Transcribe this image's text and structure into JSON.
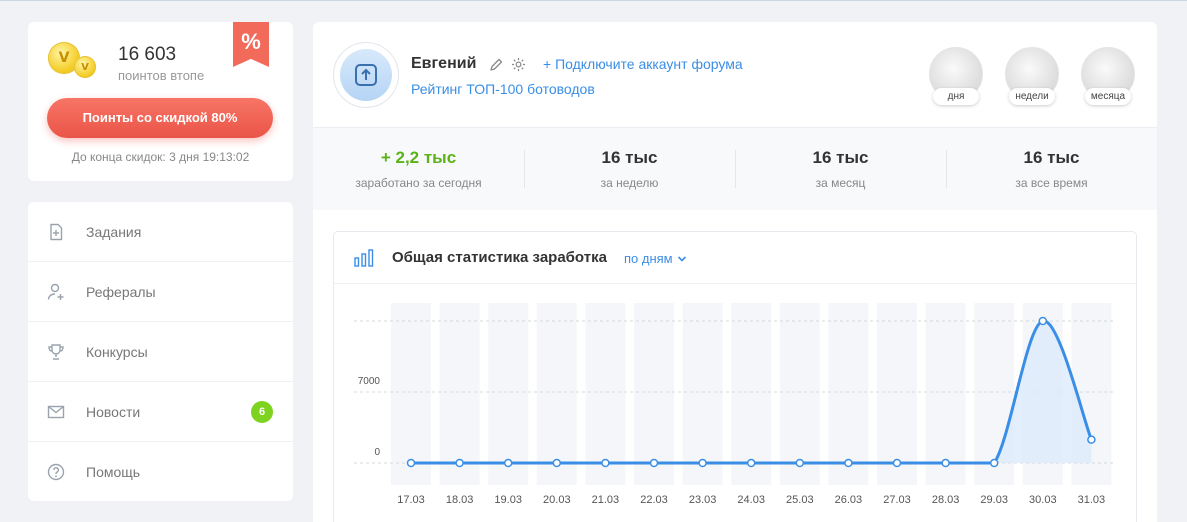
{
  "points": {
    "value": "16 603",
    "label": "поинтов втопе",
    "badge": "%",
    "coin_symbol": "V",
    "discount_button": "Поинты со скидкой 80%",
    "countdown": "До конца скидок: 3 дня 19:13:02"
  },
  "sidebar": {
    "items": [
      {
        "label": "Задания",
        "icon": "task-icon"
      },
      {
        "label": "Рефералы",
        "icon": "user-add-icon"
      },
      {
        "label": "Конкурсы",
        "icon": "trophy-icon"
      },
      {
        "label": "Новости",
        "icon": "mail-icon",
        "badge": "6"
      },
      {
        "label": "Помощь",
        "icon": "help-icon"
      }
    ]
  },
  "profile": {
    "name": "Евгений",
    "forum_link": "+ Подключите аккаунт форума",
    "rating_link": "Рейтинг ТОП-100 ботоводов",
    "medals": [
      {
        "label": "дня"
      },
      {
        "label": "недели"
      },
      {
        "label": "месяца"
      }
    ]
  },
  "stats": [
    {
      "value": "+ 2,2 тыс",
      "label": "заработано за сегодня",
      "color": "#5bb318"
    },
    {
      "value": "16 тыс",
      "label": "за неделю"
    },
    {
      "value": "16 тыс",
      "label": "за месяц"
    },
    {
      "value": "16 тыс",
      "label": "за все время"
    }
  ],
  "chart_panel": {
    "title": "Общая статистика заработка",
    "period": "по дням"
  },
  "chart_data": {
    "type": "area",
    "x": [
      "17.03",
      "18.03",
      "19.03",
      "20.03",
      "21.03",
      "22.03",
      "23.03",
      "24.03",
      "25.03",
      "26.03",
      "27.03",
      "28.03",
      "29.03",
      "30.03",
      "31.03"
    ],
    "series": [
      {
        "values": [
          0,
          0,
          0,
          0,
          0,
          0,
          0,
          0,
          0,
          0,
          0,
          0,
          0,
          14000,
          2300
        ]
      }
    ],
    "y_ticks": [
      0,
      7000
    ],
    "ylim": [
      0,
      14000
    ],
    "grid": true,
    "colors": {
      "line": "#3a8ee6",
      "fill": "#dcebfb",
      "column": "#f4f6f9"
    }
  }
}
